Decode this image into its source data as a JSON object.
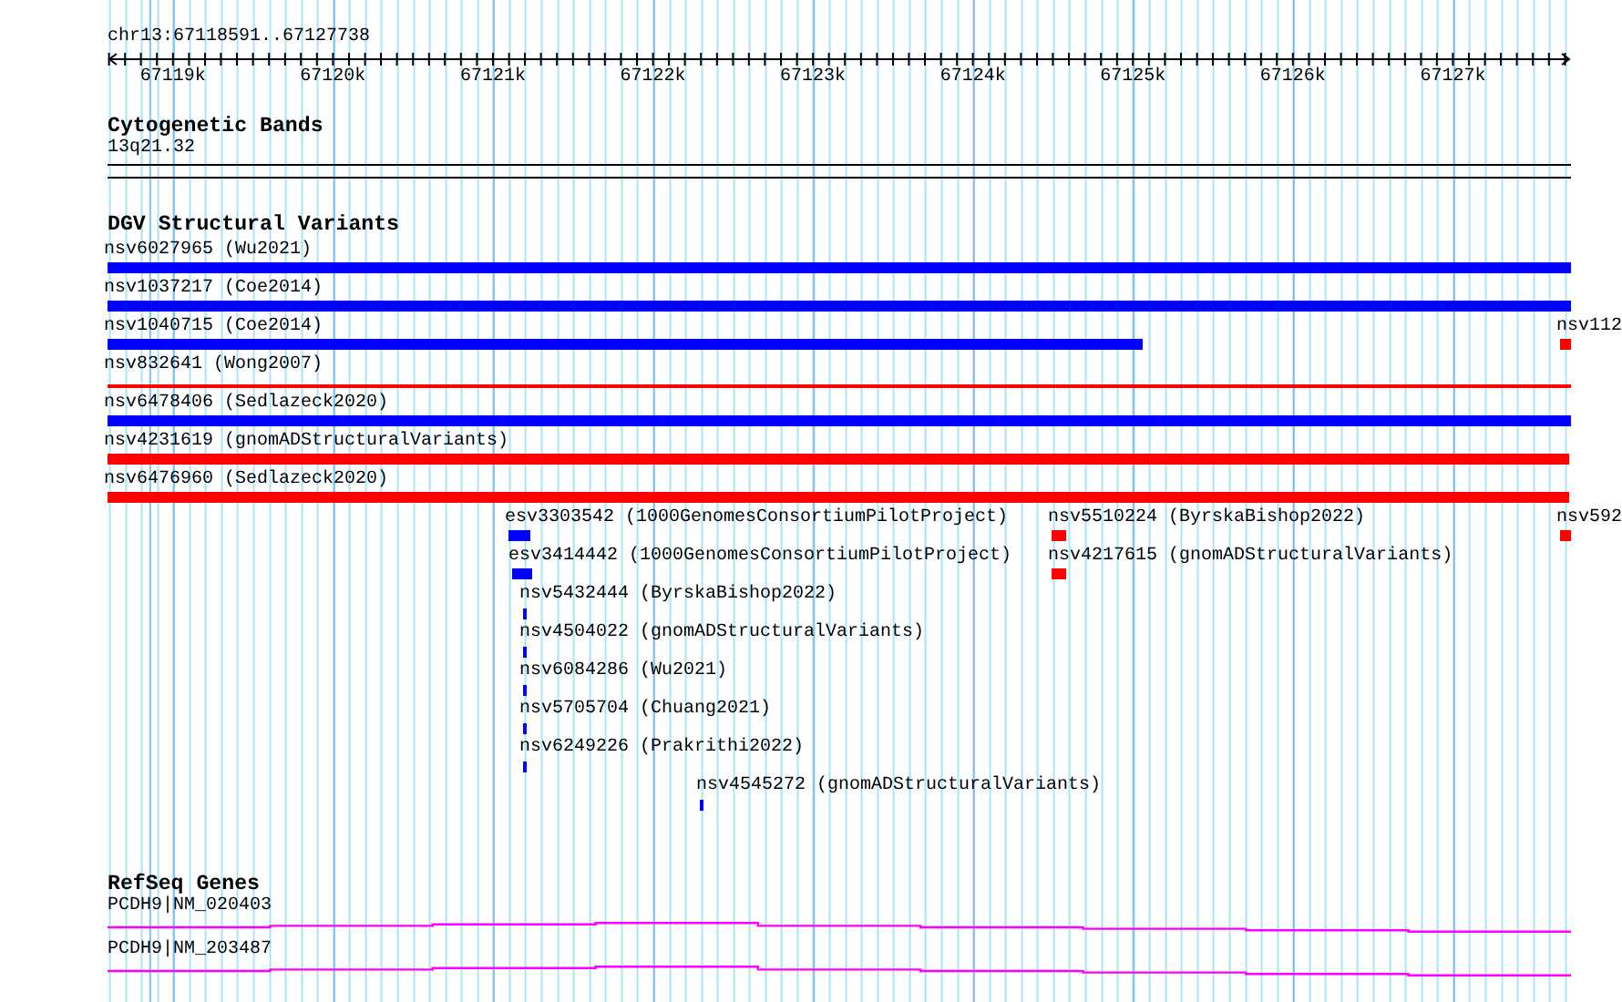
{
  "scale": {
    "location": "chr13:67118591..67127738",
    "ticks": [
      {
        "label": "67119k"
      },
      {
        "label": "67120k"
      },
      {
        "label": "67121k"
      },
      {
        "label": "67122k"
      },
      {
        "label": "67123k"
      },
      {
        "label": "67124k"
      },
      {
        "label": "67125k"
      },
      {
        "label": "67126k"
      },
      {
        "label": "67127k"
      }
    ]
  },
  "cytogenetic_bands": {
    "title": "Cytogenetic Bands",
    "band": "13q21.32"
  },
  "dgv_track": {
    "title": "DGV Structural Variants",
    "lanes": [
      [
        {
          "label": "nsv6027965 (Wu2021)",
          "kind": "bar",
          "color": "#0000ff"
        }
      ],
      [
        {
          "label": "nsv1037217 (Coe2014)",
          "kind": "bar",
          "color": "#0000ff"
        }
      ],
      [
        {
          "label": "nsv1040715 (Coe2014)",
          "kind": "bar",
          "color": "#0000ff"
        },
        {
          "label": "nsv112",
          "kind": "bar",
          "color": "#ff0000"
        }
      ],
      [
        {
          "label": "nsv832641 (Wong2007)",
          "kind": "line",
          "color": "#ff0000"
        }
      ],
      [
        {
          "label": "nsv6478406 (Sedlazeck2020)",
          "kind": "bar",
          "color": "#0000ff"
        }
      ],
      [
        {
          "label": "nsv4231619 (gnomADStructuralVariants)",
          "kind": "bar",
          "color": "#ff0000"
        }
      ],
      [
        {
          "label": "nsv6476960 (Sedlazeck2020)",
          "kind": "bar",
          "color": "#ff0000"
        }
      ],
      [
        {
          "label": "esv3303542 (1000GenomesConsortiumPilotProject)",
          "kind": "bar",
          "color": "#0000ff"
        },
        {
          "label": "nsv5510224 (ByrskaBishop2022)",
          "kind": "bar",
          "color": "#ff0000"
        },
        {
          "label": "nsv592",
          "kind": "bar",
          "color": "#ff0000"
        }
      ],
      [
        {
          "label": "esv3414442 (1000GenomesConsortiumPilotProject)",
          "kind": "bar",
          "color": "#0000ff"
        },
        {
          "label": "nsv4217615 (gnomADStructuralVariants)",
          "kind": "bar",
          "color": "#ff0000"
        }
      ],
      [
        {
          "label": "nsv5432444 (ByrskaBishop2022)",
          "kind": "tick",
          "color": "#0000ff"
        }
      ],
      [
        {
          "label": "nsv4504022 (gnomADStructuralVariants)",
          "kind": "tick",
          "color": "#0000ff"
        }
      ],
      [
        {
          "label": "nsv6084286 (Wu2021)",
          "kind": "tick",
          "color": "#0000ff"
        }
      ],
      [
        {
          "label": "nsv5705704 (Chuang2021)",
          "kind": "tick",
          "color": "#0000ff"
        }
      ],
      [
        {
          "label": "nsv6249226 (Prakrithi2022)",
          "kind": "tick",
          "color": "#0000ff"
        }
      ],
      [
        {
          "label": "nsv4545272 (gnomADStructuralVariants)",
          "kind": "tick",
          "color": "#0000ff"
        }
      ]
    ]
  },
  "refseq_genes": {
    "title": "RefSeq Genes",
    "transcripts": [
      {
        "label": "PCDH9|NM_020403"
      },
      {
        "label": "PCDH9|NM_203487"
      }
    ]
  }
}
